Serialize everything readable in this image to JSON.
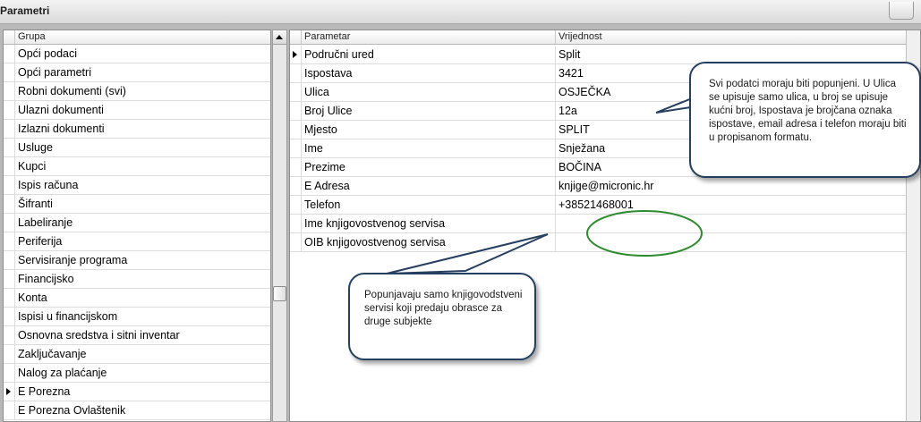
{
  "window": {
    "title": "Parametri"
  },
  "left_grid": {
    "header": "Grupa",
    "items": [
      "Opći podaci",
      "Opći parametri",
      "Robni dokumenti (svi)",
      "Ulazni dokumenti",
      "Izlazni dokumenti",
      "Usluge",
      "Kupci",
      "Ispis računa",
      "Šifranti",
      "Labeliranje",
      "Periferija",
      "Servisiranje programa",
      "Financijsko",
      "Konta",
      "Ispisi u financijskom",
      "Osnovna sredstva i sitni inventar",
      "Zaključavanje",
      "Nalog za plaćanje",
      "E Porezna",
      "E Porezna Ovlaštenik"
    ]
  },
  "right_grid": {
    "header_param": "Parametar",
    "header_value": "Vrijednost",
    "rows": [
      {
        "param": "Područni ured",
        "value": "Split"
      },
      {
        "param": "Ispostava",
        "value": "3421"
      },
      {
        "param": "Ulica",
        "value": "OSJEČKA"
      },
      {
        "param": "Broj Ulice",
        "value": "12a"
      },
      {
        "param": "Mjesto",
        "value": "SPLIT"
      },
      {
        "param": "Ime",
        "value": "Snježana"
      },
      {
        "param": "Prezime",
        "value": "BOČINA"
      },
      {
        "param": "E Adresa",
        "value": "knjige@micronic.hr"
      },
      {
        "param": "Telefon",
        "value": "+38521468001"
      },
      {
        "param": "Ime knjigovostvenog servisa",
        "value": ""
      },
      {
        "param": "OIB knjigovostvenog servisa",
        "value": ""
      }
    ]
  },
  "callouts": {
    "top": "Svi podatci moraju biti popunjeni. U Ulica se upisuje samo ulica, u broj se upisuje kućni broj, Ispostava je brojčana oznaka ispostave, email adresa i telefon moraju biti u propisanom formatu.",
    "bottom": "Popunjavaju samo knjigovodstveni servisi koji predaju obrasce za druge subjekte"
  },
  "colors": {
    "callout_border": "#243f60",
    "ellipse": "#2e8b2e"
  }
}
